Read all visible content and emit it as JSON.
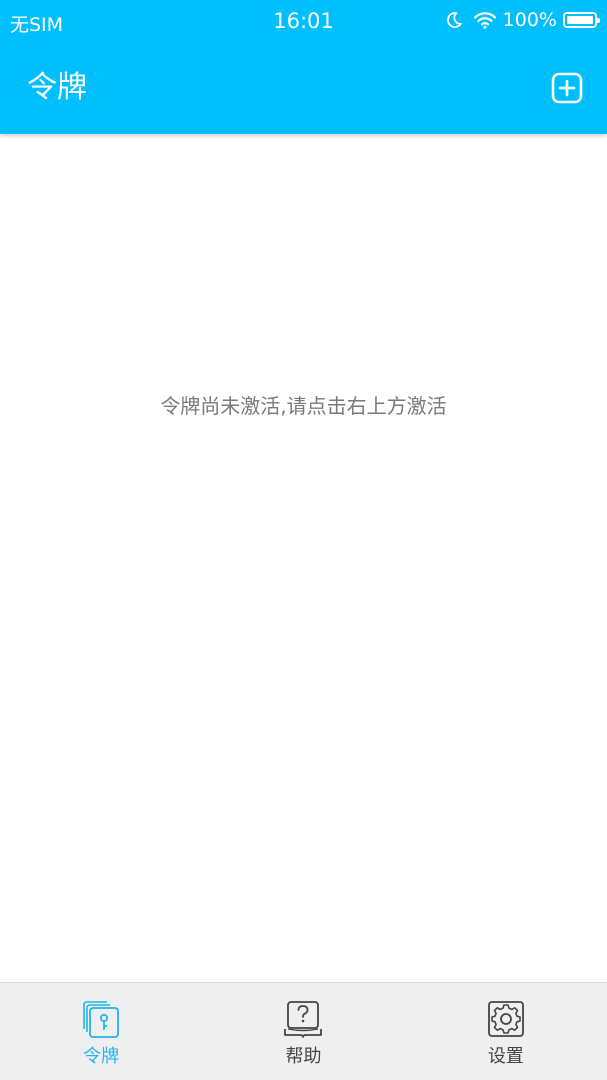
{
  "status_bar": {
    "carrier": "无SIM",
    "time": "16:01",
    "battery_percent": "100%",
    "battery_level": 1.0,
    "icons": [
      "moon-icon",
      "wifi-icon",
      "battery-icon"
    ]
  },
  "header": {
    "title": "令牌",
    "add_icon": "plus-square-icon"
  },
  "main": {
    "empty_message": "令牌尚未激活,请点击右上方激活"
  },
  "tabs": [
    {
      "label": "令牌",
      "icon": "token-card-icon",
      "active": true
    },
    {
      "label": "帮助",
      "icon": "help-book-icon",
      "active": false
    },
    {
      "label": "设置",
      "icon": "gear-icon",
      "active": false
    }
  ],
  "colors": {
    "header_bg": "#00bfff",
    "tab_active": "#1fb6ea",
    "tab_inactive": "#444444",
    "tabbar_bg": "#efefef",
    "message_text": "#7a7a7a"
  }
}
